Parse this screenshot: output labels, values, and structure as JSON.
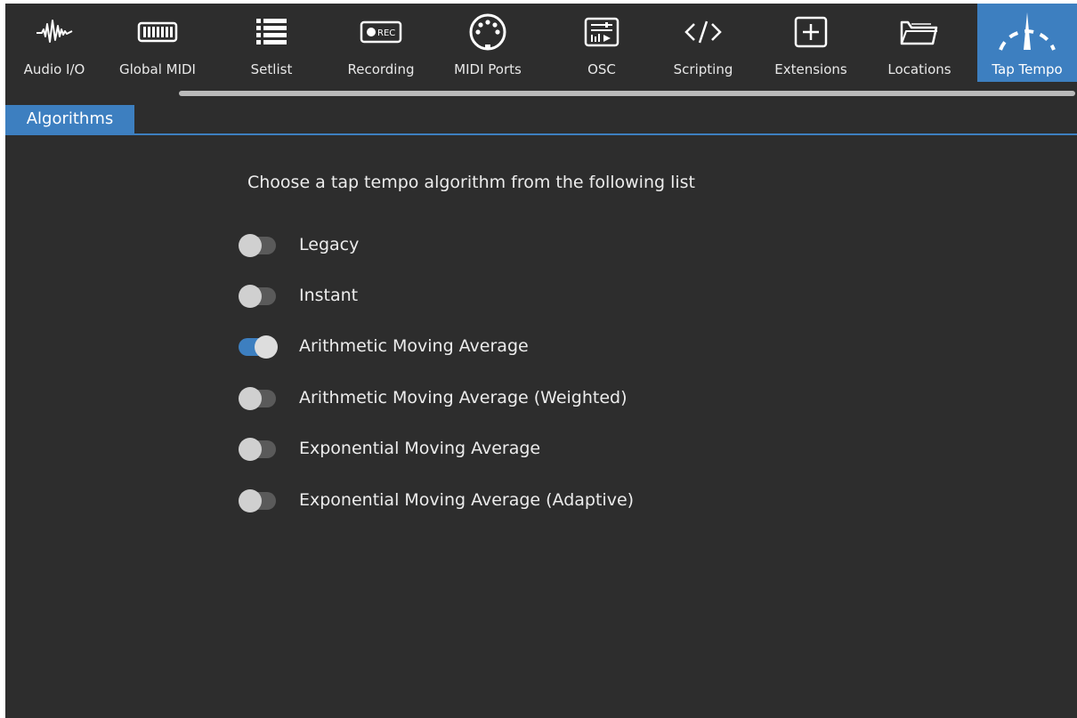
{
  "toolbar": {
    "items": [
      {
        "label": "Audio I/O",
        "icon": "waveform-icon"
      },
      {
        "label": "Global MIDI",
        "icon": "keyboard-icon"
      },
      {
        "label": "Setlist",
        "icon": "list-icon"
      },
      {
        "label": "Recording",
        "icon": "rec-icon",
        "icon_text": "REC"
      },
      {
        "label": "MIDI Ports",
        "icon": "midi-connector-icon"
      },
      {
        "label": "OSC",
        "icon": "osc-icon"
      },
      {
        "label": "Scripting",
        "icon": "code-icon"
      },
      {
        "label": "Extensions",
        "icon": "plus-box-icon"
      },
      {
        "label": "Locations",
        "icon": "folder-icon"
      },
      {
        "label": "Tap Tempo",
        "icon": "gauge-icon",
        "active": true
      }
    ]
  },
  "tabs": {
    "active": "Algorithms"
  },
  "content": {
    "instruction": "Choose a tap tempo algorithm from the following list",
    "options": [
      {
        "label": "Legacy",
        "selected": false
      },
      {
        "label": "Instant",
        "selected": false
      },
      {
        "label": "Arithmetic Moving Average",
        "selected": true
      },
      {
        "label": "Arithmetic Moving Average (Weighted)",
        "selected": false
      },
      {
        "label": "Exponential Moving Average",
        "selected": false
      },
      {
        "label": "Exponential Moving Average (Adaptive)",
        "selected": false
      }
    ]
  },
  "colors": {
    "background": "#2d2d2d",
    "accent": "#3d7fc0",
    "text": "#ececec",
    "switch_off_knob": "#d0d0d0",
    "switch_off_track": "#5a5a5a"
  }
}
